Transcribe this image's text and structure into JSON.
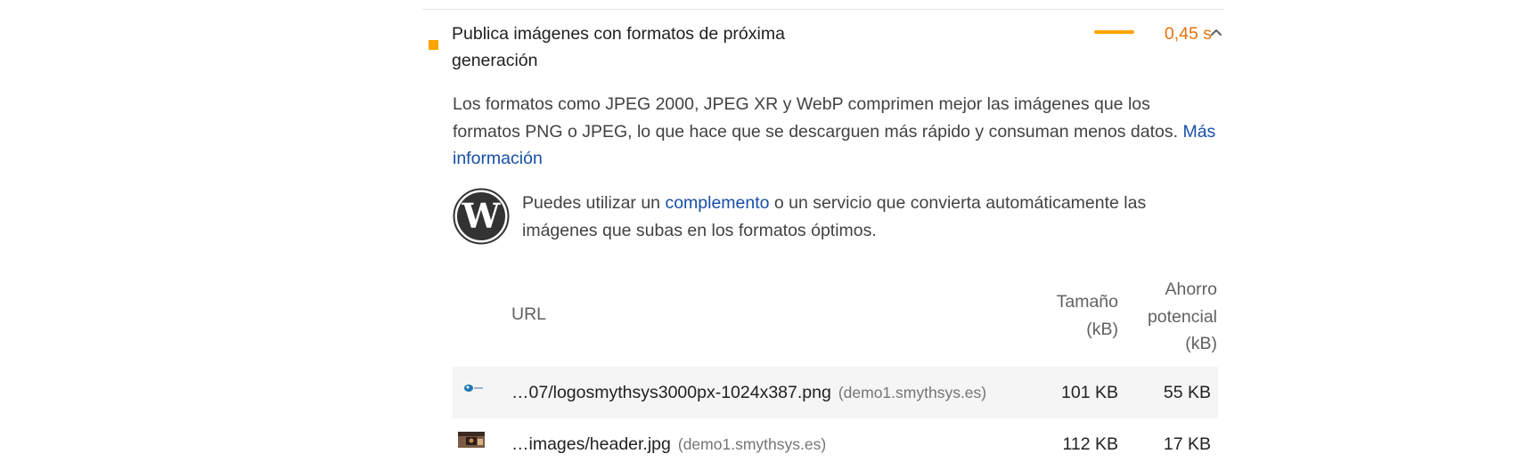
{
  "audit": {
    "title": "Publica imágenes con formatos de próxima generación",
    "score_value": "0,45 s",
    "status_color": "#ffa400",
    "score_color": "#e8710a",
    "expanded_icon": "chevron-up-icon"
  },
  "description": {
    "text": "Los formatos como JPEG 2000, JPEG XR y WebP comprimen mejor las imágenes que los formatos PNG o JPEG, lo que hace que se descarguen más rápido y consuman menos datos. ",
    "link_label": "Más información"
  },
  "stack_pack": {
    "icon": "wordpress-icon",
    "text_before": "Puedes utilizar un ",
    "link_label": "complemento",
    "text_after": " o un servicio que convierta automáticamente las imágenes que subas en los formatos óptimos."
  },
  "table": {
    "headers": {
      "url": "URL",
      "size_line1": "Tamaño",
      "size_line2": "(kB)",
      "savings_line1": "Ahorro",
      "savings_line2": "potencial",
      "savings_line3": "(kB)"
    },
    "rows": [
      {
        "thumbnail": "logo-thumbnail",
        "url": "…07/logosmythsys3000px-1024x387.png",
        "origin": "(demo1.smythsys.es)",
        "size": "101 KB",
        "savings": "55 KB"
      },
      {
        "thumbnail": "header-photo-thumbnail",
        "url": "…images/header.jpg",
        "origin": "(demo1.smythsys.es)",
        "size": "112 KB",
        "savings": "17 KB"
      }
    ]
  }
}
